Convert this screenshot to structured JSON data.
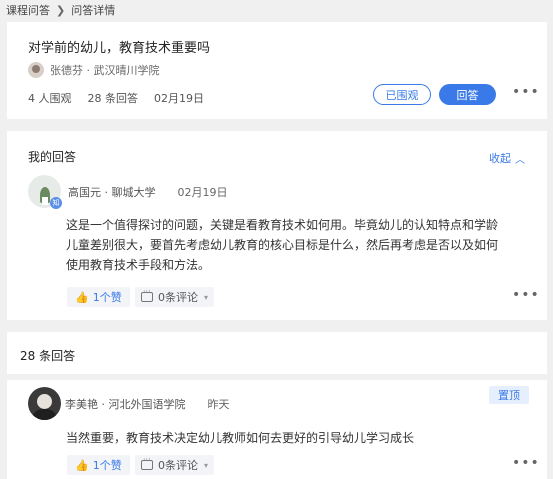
{
  "breadcrumb": {
    "parent": "课程问答",
    "current": "问答详情",
    "separator": "❯"
  },
  "question": {
    "title": "对学前的幼儿，教育技术重要吗",
    "author": "张德芬",
    "school": "武汉晴川学院",
    "views": "4 人围观",
    "answers": "28 条回答",
    "date": "02月19日",
    "watched_label": "已围观",
    "answer_label": "回答",
    "more": "•••"
  },
  "my_answer": {
    "section_title": "我的回答",
    "collapse_label": "收起",
    "author": "高国元",
    "school": "聊城大学",
    "date": "02月19日",
    "badge": "知",
    "body": "这是一个值得探讨的问题，关键是看教育技术如何用。毕竟幼儿的认知特点和学龄儿童差别很大，要首先考虑幼儿教育的核心目标是什么，然后再考虑是否以及如何使用教育技术手段和方法。",
    "likes": "1个赞",
    "comments": "0条评论",
    "more": "•••"
  },
  "answers_section": {
    "count_label": "28 条回答",
    "items": [
      {
        "author": "李美艳",
        "school": "河北外国语学院",
        "date": "昨天",
        "pin_label": "置顶",
        "body": "当然重要，教育技术决定幼儿教师如何去更好的引导幼儿学习成长",
        "likes": "1个赞",
        "comments": "0条评论",
        "more": "•••"
      }
    ]
  },
  "colors": {
    "accent": "#3a7ae8",
    "background": "#f0f0f0",
    "card": "#ffffff"
  }
}
